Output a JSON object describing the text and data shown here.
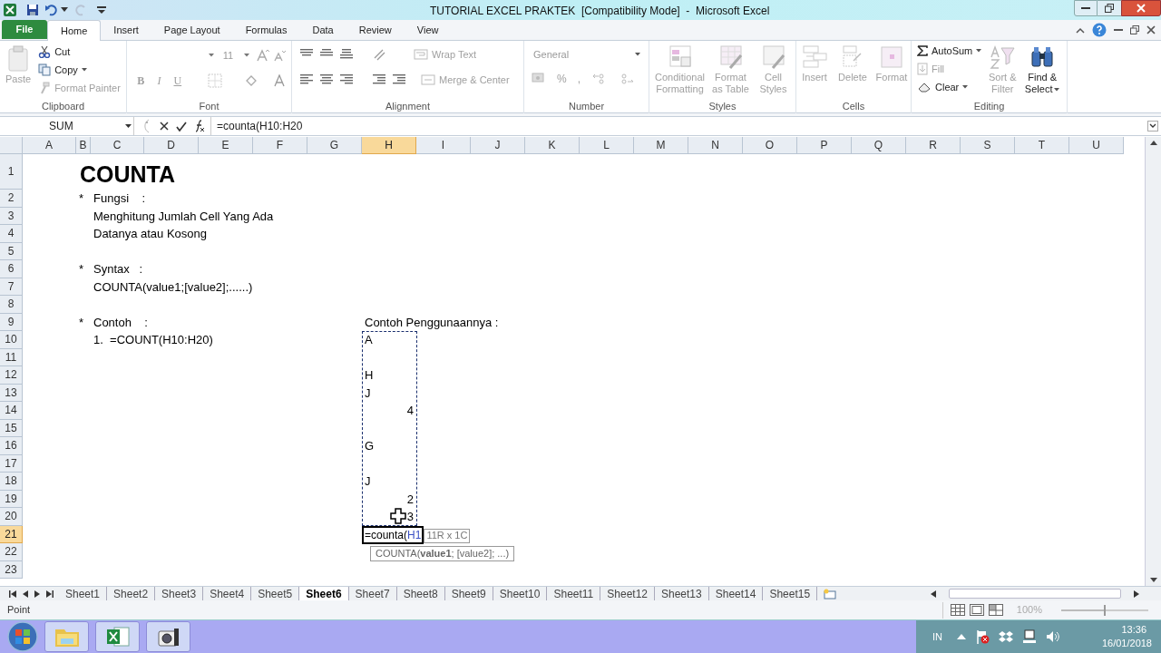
{
  "window": {
    "title": "TUTORIAL EXCEL PRAKTEK  [Compatibility Mode]  -  Microsoft Excel"
  },
  "ribbon_tabs": [
    {
      "label": "File",
      "kind": "file",
      "selected": false
    },
    {
      "label": "Home",
      "kind": "tab",
      "selected": true
    },
    {
      "label": "Insert",
      "kind": "tab",
      "selected": false
    },
    {
      "label": "Page Layout",
      "kind": "tab",
      "selected": false
    },
    {
      "label": "Formulas",
      "kind": "tab",
      "selected": false
    },
    {
      "label": "Data",
      "kind": "tab",
      "selected": false
    },
    {
      "label": "Review",
      "kind": "tab",
      "selected": false
    },
    {
      "label": "View",
      "kind": "tab",
      "selected": false
    }
  ],
  "ribbon_groups": [
    {
      "label": "Clipboard",
      "buttons": [
        {
          "label": "Paste",
          "disabled": true
        },
        {
          "label": "Cut",
          "disabled": false
        },
        {
          "label": "Copy",
          "disabled": false
        },
        {
          "label": "Format Painter",
          "disabled": true
        }
      ]
    },
    {
      "label": "Font",
      "font_size": "11",
      "buttons": [
        {
          "label": "B",
          "disabled": true
        },
        {
          "label": "I",
          "disabled": true
        },
        {
          "label": "U",
          "disabled": true
        }
      ]
    },
    {
      "label": "Alignment",
      "buttons": [
        {
          "label": "Wrap Text",
          "disabled": true
        },
        {
          "label": "Merge & Center",
          "disabled": true
        }
      ]
    },
    {
      "label": "Number",
      "format": "General",
      "buttons": [
        {
          "label": "%",
          "disabled": true
        },
        {
          "label": ",",
          "disabled": true
        }
      ]
    },
    {
      "label": "Styles",
      "buttons": [
        {
          "label": "Conditional Formatting",
          "disabled": true
        },
        {
          "label": "Format as Table",
          "disabled": true
        },
        {
          "label": "Cell Styles",
          "disabled": true
        }
      ]
    },
    {
      "label": "Cells",
      "buttons": [
        {
          "label": "Insert",
          "disabled": true
        },
        {
          "label": "Delete",
          "disabled": true
        },
        {
          "label": "Format",
          "disabled": true
        }
      ]
    },
    {
      "label": "Editing",
      "buttons": [
        {
          "label": "AutoSum",
          "disabled": false
        },
        {
          "label": "Fill",
          "disabled": true
        },
        {
          "label": "Clear",
          "disabled": false
        },
        {
          "label": "Sort & Filter",
          "disabled": true
        },
        {
          "label": "Find & Select",
          "disabled": false
        }
      ]
    }
  ],
  "formula_bar": {
    "name_box": "SUM",
    "formula": "=counta(H10:H20"
  },
  "columns": [
    {
      "label": "A",
      "selected": false
    },
    {
      "label": "B",
      "selected": false
    },
    {
      "label": "C",
      "selected": false
    },
    {
      "label": "D",
      "selected": false
    },
    {
      "label": "E",
      "selected": false
    },
    {
      "label": "F",
      "selected": false
    },
    {
      "label": "G",
      "selected": false
    },
    {
      "label": "H",
      "selected": true
    },
    {
      "label": "I",
      "selected": false
    },
    {
      "label": "J",
      "selected": false
    },
    {
      "label": "K",
      "selected": false
    },
    {
      "label": "L",
      "selected": false
    },
    {
      "label": "M",
      "selected": false
    },
    {
      "label": "N",
      "selected": false
    },
    {
      "label": "O",
      "selected": false
    },
    {
      "label": "P",
      "selected": false
    },
    {
      "label": "Q",
      "selected": false
    },
    {
      "label": "R",
      "selected": false
    },
    {
      "label": "S",
      "selected": false
    },
    {
      "label": "T",
      "selected": false
    },
    {
      "label": "U",
      "selected": false
    }
  ],
  "rows": [
    {
      "number": "1",
      "selected": false,
      "cells": {
        "B": {
          "kind": "title",
          "text": "COUNTA"
        }
      }
    },
    {
      "number": "2",
      "selected": false,
      "cells": {
        "B": {
          "kind": "text",
          "text": "*"
        },
        "C": {
          "kind": "text",
          "text": "Fungsi    :"
        }
      }
    },
    {
      "number": "3",
      "selected": false,
      "cells": {
        "C": {
          "kind": "text",
          "text": "Menghitung Jumlah Cell Yang Ada"
        }
      }
    },
    {
      "number": "4",
      "selected": false,
      "cells": {
        "C": {
          "kind": "text",
          "text": "Datanya atau Kosong"
        }
      }
    },
    {
      "number": "5",
      "selected": false,
      "cells": {}
    },
    {
      "number": "6",
      "selected": false,
      "cells": {
        "B": {
          "kind": "text",
          "text": "*"
        },
        "C": {
          "kind": "text",
          "text": "Syntax   :"
        }
      }
    },
    {
      "number": "7",
      "selected": false,
      "cells": {
        "C": {
          "kind": "text",
          "text": "COUNTA(value1;[value2];......)"
        }
      }
    },
    {
      "number": "8",
      "selected": false,
      "cells": {}
    },
    {
      "number": "9",
      "selected": false,
      "cells": {
        "B": {
          "kind": "text",
          "text": "*"
        },
        "C": {
          "kind": "text",
          "text": "Contoh    :"
        },
        "H": {
          "kind": "text",
          "text": "Contoh Penggunaannya :"
        }
      }
    },
    {
      "number": "10",
      "selected": false,
      "cells": {
        "C": {
          "kind": "text",
          "text": "1.  =COUNT(H10:H20)"
        },
        "H": {
          "kind": "text",
          "text": "A"
        }
      }
    },
    {
      "number": "11",
      "selected": false,
      "cells": {}
    },
    {
      "number": "12",
      "selected": false,
      "cells": {
        "H": {
          "kind": "text",
          "text": "H"
        }
      }
    },
    {
      "number": "13",
      "selected": false,
      "cells": {
        "H": {
          "kind": "text",
          "text": "J"
        }
      }
    },
    {
      "number": "14",
      "selected": false,
      "cells": {
        "H": {
          "kind": "number",
          "text": "4"
        }
      }
    },
    {
      "number": "15",
      "selected": false,
      "cells": {}
    },
    {
      "number": "16",
      "selected": false,
      "cells": {
        "H": {
          "kind": "text",
          "text": "G"
        }
      }
    },
    {
      "number": "17",
      "selected": false,
      "cells": {}
    },
    {
      "number": "18",
      "selected": false,
      "cells": {
        "H": {
          "kind": "text",
          "text": "J"
        }
      }
    },
    {
      "number": "19",
      "selected": false,
      "cells": {
        "H": {
          "kind": "number",
          "text": "2"
        }
      }
    },
    {
      "number": "20",
      "selected": false,
      "cells": {
        "H": {
          "kind": "number",
          "text": "3"
        }
      }
    },
    {
      "number": "21",
      "selected": true,
      "cells": {
        "H": {
          "kind": "editing",
          "text": "=counta(",
          "reference": "H1",
          "size_tip": "11R x 1C",
          "function_tip": "COUNTA(**value1**; [value2]; ...)"
        }
      }
    },
    {
      "number": "22",
      "selected": false,
      "cells": {}
    },
    {
      "number": "23",
      "selected": false,
      "cells": {}
    }
  ],
  "sheet_tabs": [
    {
      "label": "Sheet1",
      "selected": false
    },
    {
      "label": "Sheet2",
      "selected": false
    },
    {
      "label": "Sheet3",
      "selected": false
    },
    {
      "label": "Sheet4",
      "selected": false
    },
    {
      "label": "Sheet5",
      "selected": false
    },
    {
      "label": "Sheet6",
      "selected": true
    },
    {
      "label": "Sheet7",
      "selected": false
    },
    {
      "label": "Sheet8",
      "selected": false
    },
    {
      "label": "Sheet9",
      "selected": false
    },
    {
      "label": "Sheet10",
      "selected": false
    },
    {
      "label": "Sheet11",
      "selected": false
    },
    {
      "label": "Sheet12",
      "selected": false
    },
    {
      "label": "Sheet13",
      "selected": false
    },
    {
      "label": "Sheet14",
      "selected": false
    },
    {
      "label": "Sheet15",
      "selected": false
    }
  ],
  "status_bar": {
    "mode": "Point",
    "zoom": "100%",
    "zoom_slider": {
      "level": 0.5
    }
  },
  "taskbar": {
    "language": "IN",
    "time": "13:36",
    "date": "16/01/2018"
  }
}
